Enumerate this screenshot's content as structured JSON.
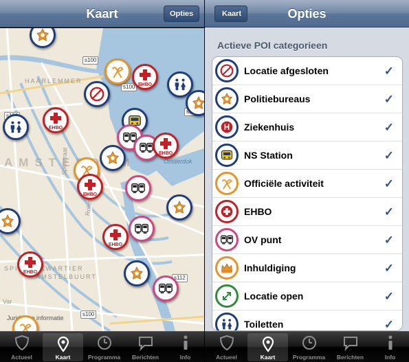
{
  "left": {
    "nav": {
      "title": "Kaart",
      "options_button": "Opties"
    },
    "map": {
      "district_big": "AMSTERDAM",
      "labels": {
        "haarlemmer": "HAARLEMMER",
        "spuistraat": "Spuistraat",
        "rokin": "Rokin",
        "oosterdok": "Oosterdok",
        "plein": "PL...",
        "spiegel": "SPIEGELKWARTIER",
        "amstelbuurt": "AMSTELBUURT",
        "juridisch": "Juridische informatie",
        "var": "Var"
      },
      "road_tags": [
        "s100",
        "s100",
        "s116",
        "s100",
        "s100",
        "s112"
      ],
      "pins": [
        {
          "type": "police"
        },
        {
          "type": "ehbo"
        },
        {
          "type": "toilet"
        },
        {
          "type": "official"
        },
        {
          "type": "closed"
        },
        {
          "type": "toilet"
        },
        {
          "type": "ehbo"
        },
        {
          "type": "ns"
        },
        {
          "type": "ov"
        },
        {
          "type": "ov"
        },
        {
          "type": "ehbo"
        },
        {
          "type": "police"
        },
        {
          "type": "official"
        },
        {
          "type": "ehbo"
        },
        {
          "type": "ov"
        },
        {
          "type": "police"
        },
        {
          "type": "police"
        },
        {
          "type": "ov"
        },
        {
          "type": "ehbo"
        },
        {
          "type": "ehbo"
        },
        {
          "type": "police"
        },
        {
          "type": "ov"
        },
        {
          "type": "police"
        },
        {
          "type": "official"
        }
      ],
      "ehbo_text": "EHBO"
    },
    "tabs": [
      {
        "label": "Actueel",
        "icon": "shield-icon"
      },
      {
        "label": "Kaart",
        "icon": "map-pin-icon"
      },
      {
        "label": "Programma",
        "icon": "clock-icon"
      },
      {
        "label": "Berichten",
        "icon": "speech-bubble-icon"
      },
      {
        "label": "Info",
        "icon": "info-icon"
      }
    ],
    "active_tab": "Kaart"
  },
  "right": {
    "nav": {
      "title": "Opties",
      "back_button": "Kaart"
    },
    "section_header": "Actieve POI categorieen",
    "categories": [
      {
        "label": "Locatie afgesloten",
        "icon": "no-entry-icon",
        "checked": true,
        "check": "✓"
      },
      {
        "label": "Politiebureaus",
        "icon": "police-badge-icon",
        "checked": true,
        "check": "✓"
      },
      {
        "label": "Ziekenhuis",
        "icon": "hospital-h-icon",
        "checked": true,
        "check": "✓"
      },
      {
        "label": "NS Station",
        "icon": "train-icon",
        "checked": true,
        "check": "✓"
      },
      {
        "label": "Officiële activiteit",
        "icon": "ribbon-icon",
        "checked": true,
        "check": "✓"
      },
      {
        "label": "EHBO",
        "icon": "first-aid-icon",
        "checked": true,
        "check": "✓"
      },
      {
        "label": "OV punt",
        "icon": "public-transport-icon",
        "checked": true,
        "check": "✓"
      },
      {
        "label": "Inhuldiging",
        "icon": "crown-icon",
        "checked": true,
        "check": "✓"
      },
      {
        "label": "Locatie open",
        "icon": "open-arrows-icon",
        "checked": true,
        "check": "✓"
      },
      {
        "label": "Toiletten",
        "icon": "toilet-icon",
        "checked": true,
        "check": "✓"
      }
    ],
    "tabs": [
      {
        "label": "Actueel",
        "icon": "shield-icon"
      },
      {
        "label": "Kaart",
        "icon": "map-pin-icon"
      },
      {
        "label": "Programma",
        "icon": "clock-icon"
      },
      {
        "label": "Berichten",
        "icon": "speech-bubble-icon"
      },
      {
        "label": "Info",
        "icon": "info-icon"
      }
    ],
    "active_tab": "Kaart"
  },
  "colors": {
    "red": "#c41f24",
    "navy": "#1f3d7a",
    "orange": "#e8922a",
    "green": "#2f8a3a",
    "pink": "#d0477f",
    "check": "#385487",
    "water": "#a6c6e0"
  }
}
